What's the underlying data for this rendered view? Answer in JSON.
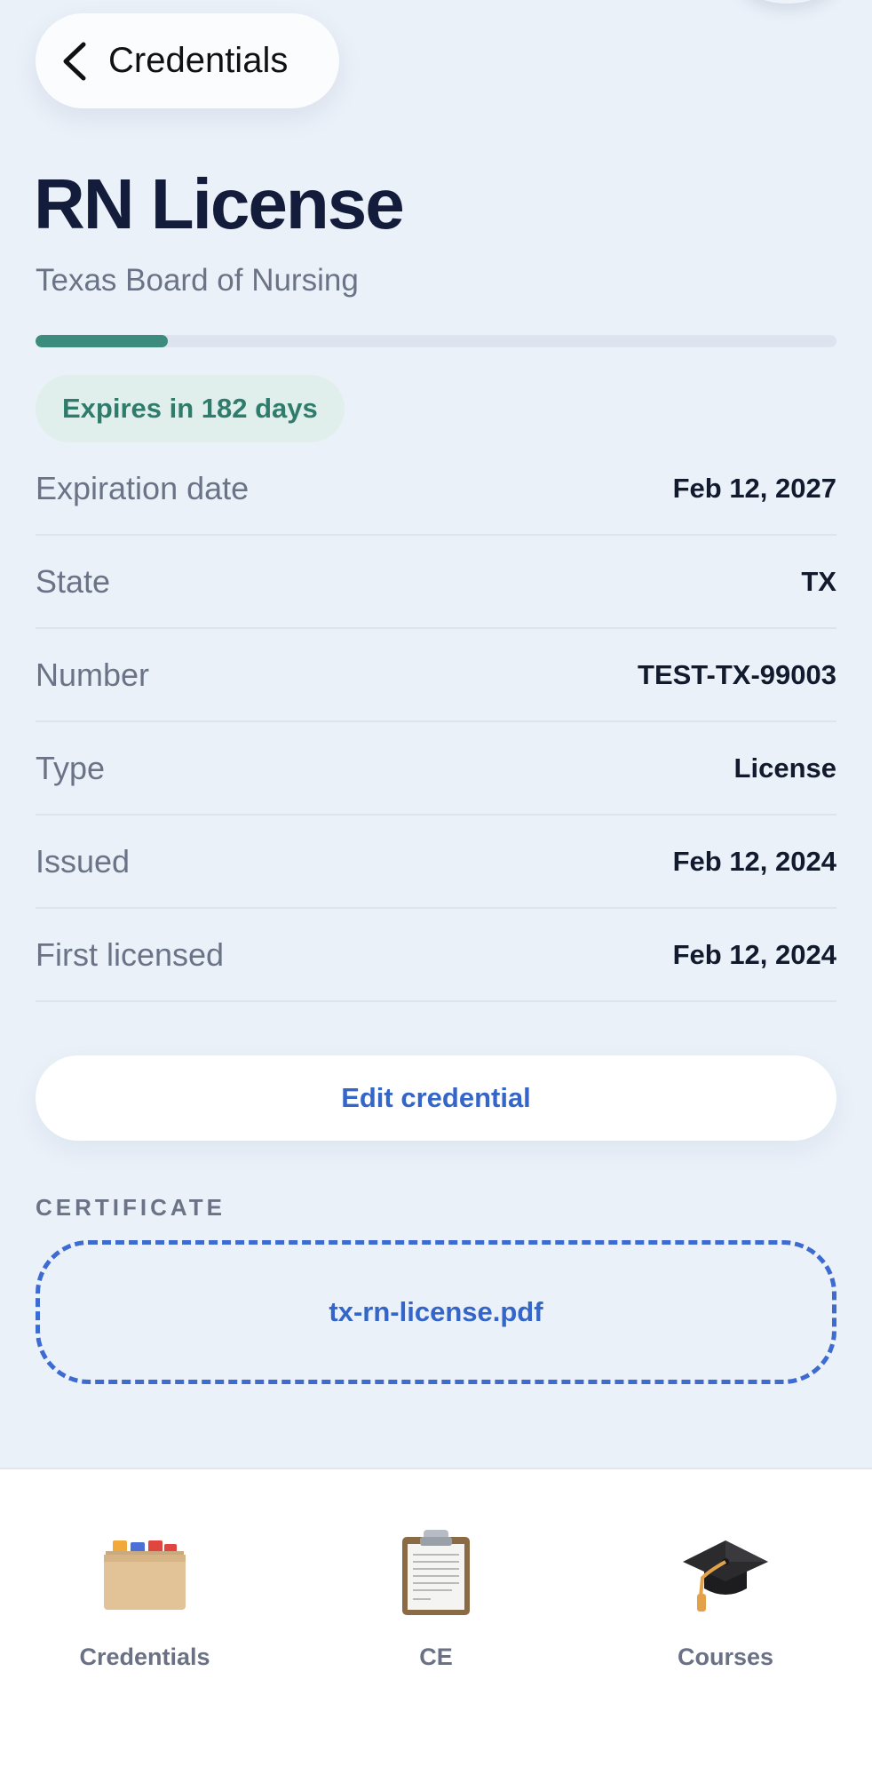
{
  "header": {
    "back_label": "Credentials",
    "title": "RN License",
    "subtitle": "Texas Board of Nursing"
  },
  "progress": {
    "fraction": 0.165,
    "color": "#3c8b7d"
  },
  "badge": {
    "text": "Expires in 182 days"
  },
  "details": [
    {
      "label": "Expiration date",
      "value": "Feb 12, 2027"
    },
    {
      "label": "State",
      "value": "TX"
    },
    {
      "label": "Number",
      "value": "TEST-TX-99003"
    },
    {
      "label": "Type",
      "value": "License"
    },
    {
      "label": "Issued",
      "value": "Feb 12, 2024"
    },
    {
      "label": "First licensed",
      "value": "Feb 12, 2024"
    }
  ],
  "edit_button": {
    "label": "Edit credential"
  },
  "certificate": {
    "section_label": "CERTIFICATE",
    "file_name": "tx-rn-license.pdf"
  },
  "tabbar": {
    "items": [
      {
        "label": "Credentials",
        "icon": "card-file-box-icon"
      },
      {
        "label": "CE",
        "icon": "clipboard-icon"
      },
      {
        "label": "Courses",
        "icon": "graduation-cap-icon"
      }
    ]
  },
  "colors": {
    "background": "#eaf1f9",
    "accent_blue": "#3465c8",
    "accent_green": "#2f7c6c",
    "title": "#131d3b"
  }
}
